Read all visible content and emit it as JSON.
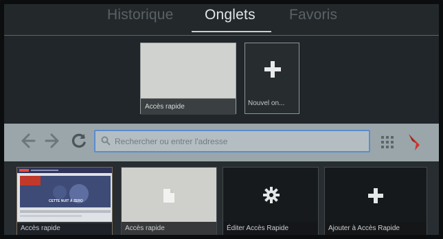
{
  "tabs": [
    {
      "label": "Historique",
      "active": false
    },
    {
      "label": "Onglets",
      "active": true
    },
    {
      "label": "Favoris",
      "active": false
    }
  ],
  "top_tiles": {
    "speed_dial_label": "Accès rapide",
    "new_tab_label": "Nouvel on..."
  },
  "address_bar": {
    "placeholder": "Rechercher ou entrer l'adresse",
    "back_icon": "back-arrow-icon",
    "forward_icon": "forward-arrow-icon",
    "reload_icon": "reload-icon",
    "grid_icon": "apps-grid-icon"
  },
  "bottom_tiles": [
    {
      "label": "Accès rapide",
      "icon": "website-thumbnail"
    },
    {
      "label": "Accès rapide",
      "icon": "document-icon"
    },
    {
      "label": "Éditer Accès Rapide",
      "icon": "gear-icon"
    },
    {
      "label": "Ajouter à Accès Rapide",
      "icon": "plus-icon"
    }
  ],
  "thumbnail_text": "CETTE NUIT À ZERO",
  "colors": {
    "accent_border": "#5b8cd0",
    "logo_red": "#d0342c"
  }
}
